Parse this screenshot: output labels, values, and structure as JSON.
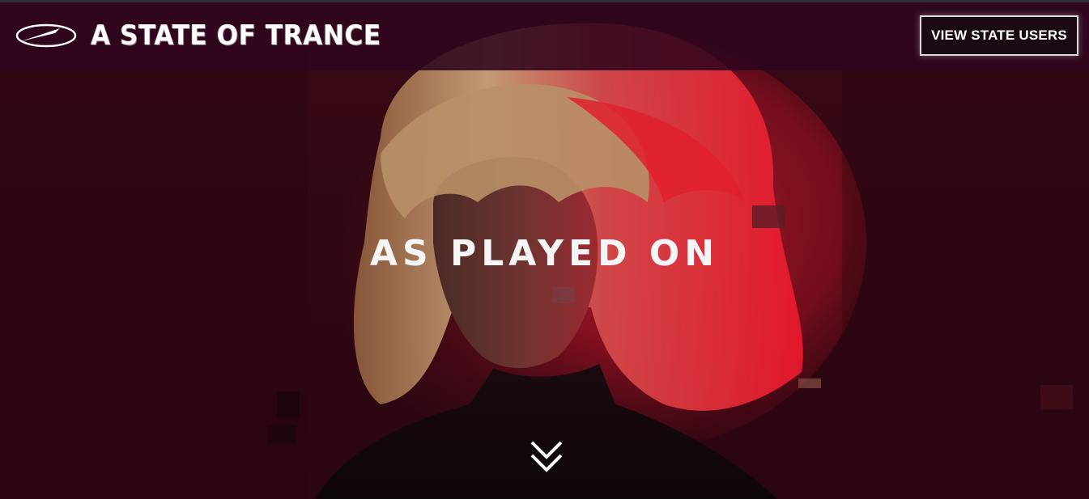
{
  "header": {
    "logo_text": "A STATE OF TRANCE",
    "logo_icon": "asot-arrow-logo-icon",
    "cta_label": "VIEW STATE USERS"
  },
  "hero": {
    "headline": "AS PLAYED ON",
    "scroll_icon": "double-chevron-down-icon"
  },
  "colors": {
    "header_bg": "#30061e",
    "page_bg": "#300713",
    "accent_red": "#d11826",
    "text": "#ffffff"
  }
}
